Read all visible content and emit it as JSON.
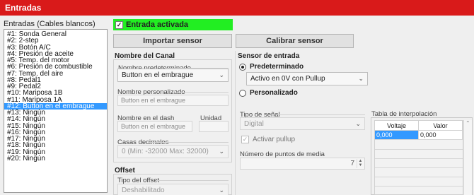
{
  "window": {
    "title": "Entradas"
  },
  "left": {
    "header": "Entradas (Cables blancos)",
    "items": [
      "#1: Sonda General",
      "#2: 2-step",
      "#3: Botón A/C",
      "#4: Presión de aceite",
      "#5: Temp. del motor",
      "#6: Presión de combustible",
      "#7: Temp. del aire",
      "#8: Pedal1",
      "#9: Pedal2",
      "#10: Mariposa 1B",
      "#11: Mariposa 1A",
      "#12: Button en el embrague",
      "#13: Ningún",
      "#14: Ningún",
      "#15: Ningún",
      "#16: Ningún",
      "#17: Ningún",
      "#18: Ningún",
      "#19: Ningún",
      "#20: Ningún"
    ],
    "selected_index": 11
  },
  "enabled": {
    "label": "Entrada activada",
    "checked": true,
    "check_glyph": "✓"
  },
  "buttons": {
    "import": "Importar sensor",
    "calibrate": "Calibrar sensor"
  },
  "channel_name": {
    "title": "Nombre del Canal",
    "default_label": "Nombre predeterminado",
    "default_value": "Button en el embrague",
    "custom_label": "Nombre personalizado",
    "custom_value": "Button en el embrague",
    "dash_label": "Nombre en el dash",
    "dash_value": "Button en el embrague",
    "unit_label": "Unidad",
    "unit_value": "",
    "decimals_label": "Casas decimales",
    "decimals_value": "0 (Min: -32000  Max: 32000)"
  },
  "offset": {
    "title": "Offset",
    "type_label": "Tipo del offset",
    "type_value": "Deshabilitado"
  },
  "sensor_input": {
    "title": "Sensor de entrada",
    "default_radio": "Predeterminado",
    "default_value": "Activo en 0V con Pullup",
    "custom_radio": "Personalizado",
    "signal_label": "Tipo de señal",
    "signal_value": "Digital",
    "pullup_label": "Activar pullup",
    "avg_label": "Número de puntos de media",
    "avg_value": "7"
  },
  "interpolation": {
    "title": "Tabla de interpolación",
    "columns": [
      "Voltaje",
      "Valor"
    ],
    "rows": [
      [
        "0,000",
        "0,000"
      ]
    ]
  },
  "icons": {
    "dropdown": "chevron-down-icon",
    "spin": "spin-arrows-icon",
    "scroll_up": "scroll-up-icon"
  },
  "colors": {
    "title_bar": "#d91a1a",
    "enabled_bar": "#22ee22",
    "selection": "#3399ff"
  }
}
